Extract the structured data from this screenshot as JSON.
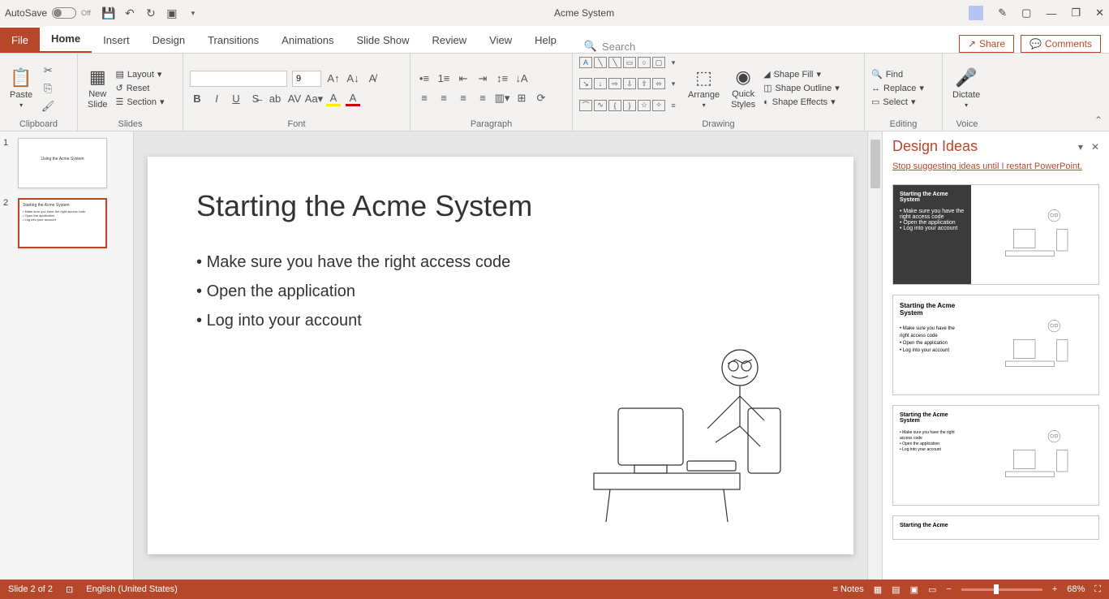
{
  "titlebar": {
    "autosave_label": "AutoSave",
    "autosave_state": "Off",
    "document_title": "Acme System"
  },
  "tabs": {
    "file": "File",
    "items": [
      "Home",
      "Insert",
      "Design",
      "Transitions",
      "Animations",
      "Slide Show",
      "Review",
      "View",
      "Help"
    ],
    "active": "Home",
    "search_placeholder": "Search",
    "share": "Share",
    "comments": "Comments"
  },
  "ribbon": {
    "clipboard": {
      "label": "Clipboard",
      "paste": "Paste"
    },
    "slides": {
      "label": "Slides",
      "new_slide": "New\nSlide",
      "layout": "Layout",
      "reset": "Reset",
      "section": "Section"
    },
    "font": {
      "label": "Font",
      "size": "9"
    },
    "paragraph": {
      "label": "Paragraph"
    },
    "drawing": {
      "label": "Drawing",
      "arrange": "Arrange",
      "quick_styles": "Quick\nStyles",
      "shape_fill": "Shape Fill",
      "shape_outline": "Shape Outline",
      "shape_effects": "Shape Effects"
    },
    "editing": {
      "label": "Editing",
      "find": "Find",
      "replace": "Replace",
      "select": "Select"
    },
    "voice": {
      "label": "Voice",
      "dictate": "Dictate"
    }
  },
  "thumbnails": [
    {
      "num": "1",
      "title": "Using the Acme System",
      "selected": false
    },
    {
      "num": "2",
      "title": "Starting the Acme System",
      "selected": true
    }
  ],
  "slide": {
    "title": "Starting the Acme System",
    "bullets": [
      "Make sure you have the right access code",
      "Open the application",
      "Log into your account"
    ]
  },
  "design_ideas": {
    "title": "Design Ideas",
    "stop_link": "Stop suggesting ideas until I restart PowerPoint.",
    "cards": [
      {
        "variant": "dark",
        "title": "Starting the Acme System"
      },
      {
        "variant": "light",
        "title": "Starting the Acme System"
      },
      {
        "variant": "light",
        "title": "Starting the Acme System"
      },
      {
        "variant": "light",
        "title": "Starting the Acme"
      }
    ],
    "card_bullets": [
      "Make sure you have the right access code",
      "Open the application",
      "Log into your account"
    ]
  },
  "statusbar": {
    "slide_info": "Slide 2 of 2",
    "language": "English (United States)",
    "notes": "Notes",
    "zoom": "68%"
  }
}
